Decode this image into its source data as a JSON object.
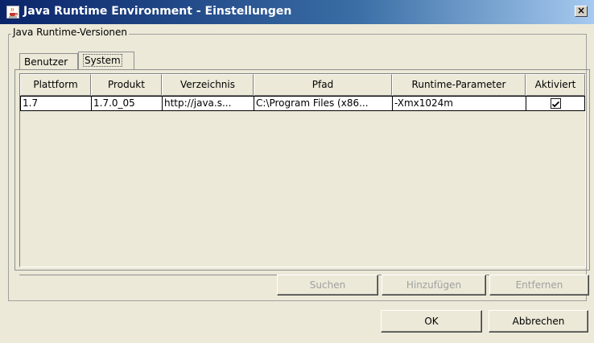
{
  "window": {
    "title": "Java Runtime Environment - Einstellungen",
    "close_glyph": "×",
    "icon": "java-cup-icon"
  },
  "group": {
    "label": "Java Runtime-Versionen"
  },
  "tabs": [
    {
      "label": "Benutzer",
      "selected": false
    },
    {
      "label": "System",
      "selected": true
    }
  ],
  "table": {
    "columns": [
      "Plattform",
      "Produkt",
      "Verzeichnis",
      "Pfad",
      "Runtime-Parameter",
      "Aktiviert"
    ],
    "rows": [
      {
        "plattform": "1.7",
        "produkt": "1.7.0_05",
        "verzeichnis": "http://java.s...",
        "pfad": "C:\\Program Files (x86...",
        "runtime_parameter": "-Xmx1024m",
        "aktiviert": true
      }
    ]
  },
  "buttons": {
    "suchen": "Suchen",
    "hinzufuegen": "Hinzufügen",
    "entfernen": "Entfernen",
    "ok": "OK",
    "abbrechen": "Abbrechen"
  },
  "colors": {
    "titlebar": "#0a246a",
    "dialog_bg": "#ece9d8",
    "disabled_text": "#a0a0a0"
  }
}
